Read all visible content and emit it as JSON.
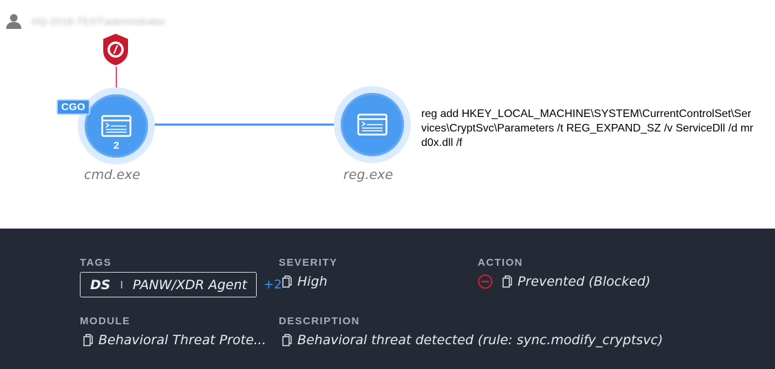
{
  "header": {
    "user_name": "HQ-2018-TEST\\administrator"
  },
  "graph": {
    "nodes": [
      {
        "label": "cmd.exe",
        "tag": "CGO",
        "count": "2"
      },
      {
        "label": "reg.exe"
      }
    ],
    "command_line": "reg add HKEY_LOCAL_MACHINE\\SYSTEM\\CurrentControlSet\\Services\\CryptSvc\\Parameters /t REG_EXPAND_SZ /v ServiceDll /d mrd0x.dll /f",
    "colors": {
      "node_fill": "#4a9bf2",
      "edge": "#3d93ef",
      "alert_shield": "#c8192e"
    }
  },
  "details": {
    "tags": {
      "label": "TAGS",
      "primary": "DS",
      "separator": "I",
      "value": "PANW/XDR Agent",
      "more": "+2"
    },
    "severity": {
      "label": "SEVERITY",
      "value": "High"
    },
    "action": {
      "label": "ACTION",
      "value": "Prevented (Blocked)"
    },
    "module": {
      "label": "MODULE",
      "value": "Behavioral Threat Prote..."
    },
    "description": {
      "label": "DESCRIPTION",
      "value": "Behavioral threat detected (rule: sync.modify_cryptsvc)"
    },
    "colors": {
      "panel_bg": "#232a36",
      "label": "#a8acb2",
      "value": "#e8eaec",
      "blocked": "#d0202e"
    }
  }
}
